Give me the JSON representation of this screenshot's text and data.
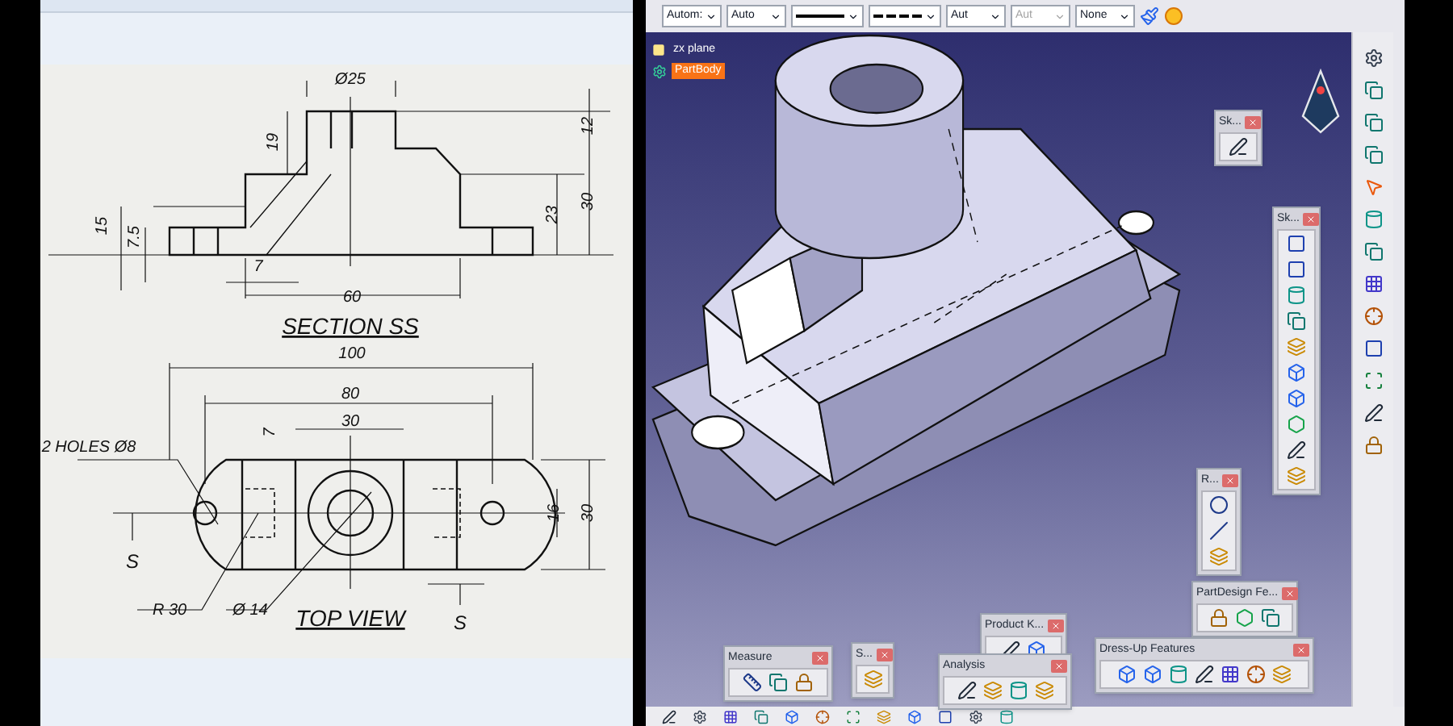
{
  "drawing": {
    "section_dims": [
      "Ø25",
      "19",
      "12",
      "30",
      "23",
      "15",
      "7.5",
      "7",
      "60"
    ],
    "section_title": "SECTION SS",
    "top_dims": [
      "100",
      "80",
      "30",
      "7",
      "2 HOLES Ø8",
      "16",
      "30",
      "R 30",
      "Ø 14"
    ],
    "top_title": "TOP VIEW",
    "section_marks": [
      "S",
      "S"
    ]
  },
  "catia": {
    "toolbar": [
      {
        "kind": "combo",
        "value": "Autom:",
        "disabled": false
      },
      {
        "kind": "combo",
        "value": "Auto",
        "disabled": false
      },
      {
        "kind": "line",
        "disabled": false
      },
      {
        "kind": "dash",
        "disabled": false
      },
      {
        "kind": "combo",
        "value": "Aut",
        "disabled": false
      },
      {
        "kind": "combo",
        "value": "Aut",
        "disabled": true
      },
      {
        "kind": "combo",
        "value": "None",
        "disabled": false
      }
    ],
    "tree": [
      {
        "label": "zx plane",
        "selected": false
      },
      {
        "label": "PartBody",
        "selected": true
      }
    ],
    "floating_toolbars": [
      {
        "title": "Sk..."
      },
      {
        "title": "Sk..."
      },
      {
        "title": "R..."
      },
      {
        "title": "PartDesign Fe..."
      },
      {
        "title": "Product K..."
      },
      {
        "title": "Measure"
      },
      {
        "title": "S..."
      },
      {
        "title": "Analysis"
      },
      {
        "title": "Dress-Up Features"
      }
    ]
  }
}
